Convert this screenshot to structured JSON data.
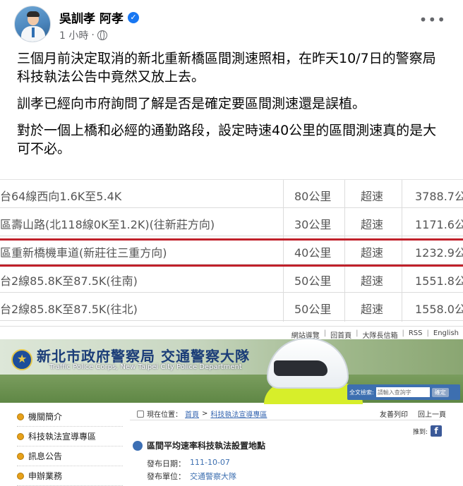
{
  "post": {
    "author": "吳訓孝 阿孝",
    "time": "1 小時",
    "separator": "·",
    "more": "•••",
    "paragraphs": [
      "三個月前決定取消的新北重新橋區間測速照相，在昨天10/7日的警察局科技執法公告中竟然又放上去。",
      "訓孝已經向市府詢問了解是否是確定要區間測速還是誤植。",
      "對於一個上橋和必經的通勤路段，設定時速40公里的區間測速真的是大可不必。"
    ]
  },
  "table": {
    "rows": [
      {
        "location": "台64線西向1.6K至5.4K",
        "speed": "80公里",
        "type": "超速",
        "value": "3788.7公"
      },
      {
        "location": "區壽山路(北118線0K至1.2K)(往新莊方向)",
        "speed": "30公里",
        "type": "超速",
        "value": "1171.6公"
      },
      {
        "location": "區重新橋機車道(新莊往三重方向)",
        "speed": "40公里",
        "type": "超速",
        "value": "1232.9公"
      },
      {
        "location": "台2線85.8K至87.5K(往南)",
        "speed": "50公里",
        "type": "超速",
        "value": "1551.8公"
      },
      {
        "location": "台2線85.8K至87.5K(往北)",
        "speed": "50公里",
        "type": "超速",
        "value": "1558.0公"
      }
    ],
    "highlight_color": "#c0202a"
  },
  "site": {
    "top_links": [
      "網站導覽",
      "回首頁",
      "大隊長信箱",
      "RSS",
      "English"
    ],
    "title": "新北市政府警察局 交通警察大隊",
    "subtitle": "Traffic Police Corps, New Taipei City Police Department",
    "search_label": "全文檢索:",
    "search_placeholder": "請輸入查詢字",
    "search_button": "確定",
    "menu": [
      "機關簡介",
      "科技執法宣導專區",
      "訊息公告",
      "申辦業務"
    ],
    "breadcrumb_prefix": "現在位置：",
    "breadcrumb_home": "首頁",
    "breadcrumb_sep": ">",
    "breadcrumb_section": "科技執法宣導專區",
    "tool_email": "友善列印",
    "tool_back": "回上一頁",
    "share_label": "推到:",
    "article_title": "區間平均速率科技執法設置地點",
    "publish_date_label": "發布日期：",
    "publish_date": "111-10-07",
    "publish_unit_label": "發布單位：",
    "publish_unit": "交通警察大隊"
  }
}
